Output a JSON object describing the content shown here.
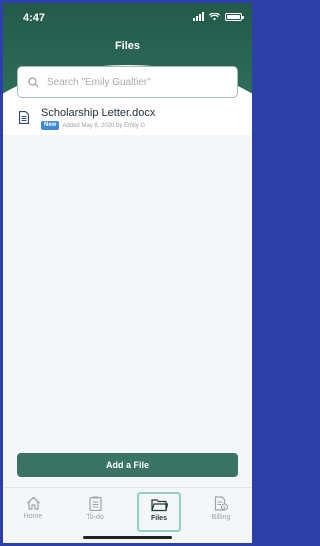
{
  "status_bar": {
    "time": "4:47"
  },
  "header": {
    "title": "Files"
  },
  "search": {
    "placeholder": "Search \"Emily Gualtier\""
  },
  "files": [
    {
      "name": "Scholarship Letter.docx",
      "badge": "New",
      "meta": "Added May 8, 2020 by Emily G"
    }
  ],
  "actions": {
    "add_file_label": "Add a File"
  },
  "tabbar": {
    "tabs": [
      {
        "label": "Home",
        "icon": "home-icon"
      },
      {
        "label": "To-do",
        "icon": "checklist-icon"
      },
      {
        "label": "Files",
        "icon": "folder-icon",
        "active": true
      },
      {
        "label": "Billing",
        "icon": "billing-icon"
      }
    ]
  },
  "colors": {
    "header": "#2f6e5c",
    "primary_button": "#3a7464",
    "badge": "#3f87d8",
    "active_tab_outline": "#8fd3c0"
  }
}
